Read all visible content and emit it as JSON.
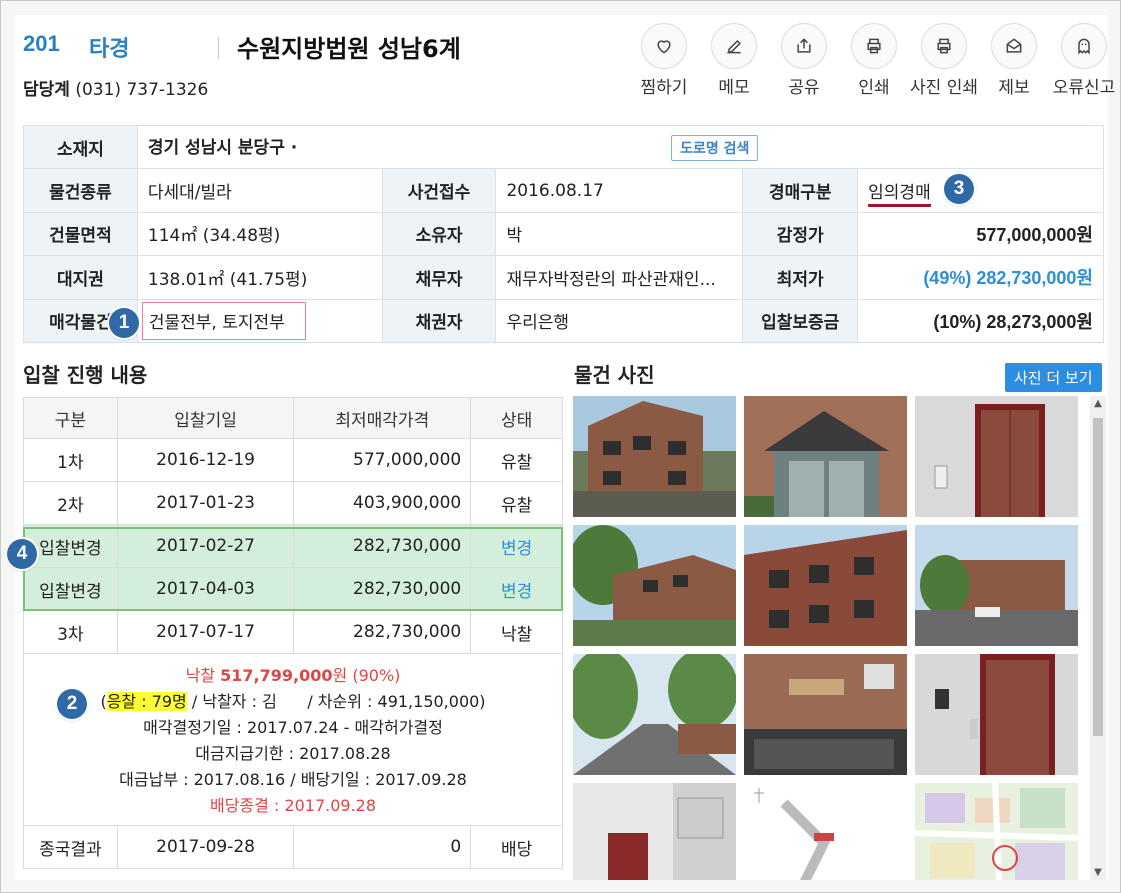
{
  "header": {
    "case_no": "201",
    "case_type": "타경",
    "court": "수원지방법원 성남6계",
    "contact_label": "담당계",
    "contact_phone": "(031) 737-1326"
  },
  "actions": [
    {
      "label": "찜하기",
      "icon": "heart-icon"
    },
    {
      "label": "메모",
      "icon": "edit-icon"
    },
    {
      "label": "공유",
      "icon": "share-icon"
    },
    {
      "label": "인쇄",
      "icon": "print-icon"
    },
    {
      "label": "사진 인쇄",
      "icon": "photo-print-icon"
    },
    {
      "label": "제보",
      "icon": "mail-icon"
    },
    {
      "label": "오류신고",
      "icon": "ghost-icon"
    }
  ],
  "info": {
    "address_label": "소재지",
    "address": "경기 성남시 분당구 ·",
    "road_search": "도로명 검색",
    "type_label": "물건종류",
    "type": "다세대/빌라",
    "receipt_label": "사건접수",
    "receipt": "2016.08.17",
    "auction_kind_label": "경매구분",
    "auction_kind": "임의경매",
    "building_area_label": "건물면적",
    "building_area": "114㎡ (34.48평)",
    "owner_label": "소유자",
    "owner": "박",
    "appraisal_label": "감정가",
    "appraisal": "577,000,000원",
    "land_right_label": "대지권",
    "land_right": "138.01㎡ (41.75평)",
    "debtor_label": "채무자",
    "debtor": "재무자박정란의 파산관재인...",
    "min_price_label": "최저가",
    "min_price": "(49%) 282,730,000원",
    "sale_object_label": "매각물건",
    "sale_object": "건물전부, 토지전부",
    "creditor_label": "채권자",
    "creditor": "우리은행",
    "deposit_label": "입찰보증금",
    "deposit": "(10%) 28,273,000원"
  },
  "badges": [
    "1",
    "2",
    "3",
    "4"
  ],
  "bidding": {
    "title": "입찰 진행 내용",
    "headers": [
      "구분",
      "입찰기일",
      "최저매각가격",
      "상태"
    ],
    "rows": [
      {
        "round": "1차",
        "date": "2016-12-19",
        "price": "577,000,000",
        "status": "유찰"
      },
      {
        "round": "2차",
        "date": "2017-01-23",
        "price": "403,900,000",
        "status": "유찰"
      },
      {
        "round": "입찰변경",
        "date": "2017-02-27",
        "price": "282,730,000",
        "status": "변경"
      },
      {
        "round": "입찰변경",
        "date": "2017-04-03",
        "price": "282,730,000",
        "status": "변경"
      },
      {
        "round": "3차",
        "date": "2017-07-17",
        "price": "282,730,000",
        "status": "낙찰"
      }
    ],
    "detail": {
      "sold_label": "낙찰",
      "sold_price": "517,799,000",
      "sold_unit": "원",
      "sold_rate": "(90%)",
      "bidders_open": "(",
      "bidders": "응찰 : 79명",
      "winner": "/ 낙찰자 : 김",
      "second": "/ 차순위 : 491,150,000)",
      "decision": "매각결정기일 : 2017.07.24 - 매각허가결정",
      "payment_deadline": "대금지급기한 : 2017.08.28",
      "payment": "대금납부 : 2017.08.16 / 배당기일 : 2017.09.28",
      "dividend_end": "배당종결 : 2017.09.28"
    },
    "final": {
      "round": "종국결과",
      "date": "2017-09-28",
      "price": "0",
      "status": "배당"
    }
  },
  "photos": {
    "title": "물건 사진",
    "more_label": "사진 더 보기"
  },
  "colors": {
    "accent": "#2b7fc3",
    "link_blue": "#2c8fd6",
    "red": "#e04545",
    "highlight_green": "#d4eedc"
  }
}
